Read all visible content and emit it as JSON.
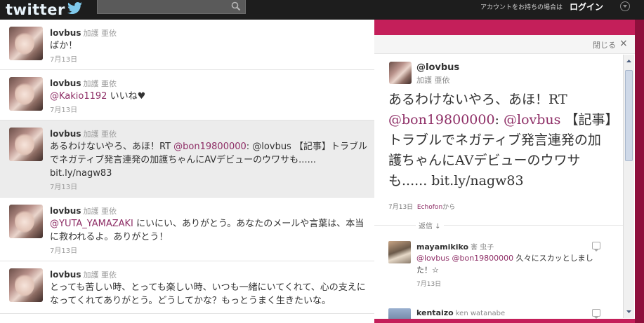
{
  "header": {
    "logo_text": "twitter",
    "search_placeholder": "",
    "account_prompt": "アカウントをお持ちの場合は",
    "login_label": "ログイン"
  },
  "timeline": [
    {
      "username": "lovbus",
      "fullname": "加護 亜依",
      "text_pre": "ばか！",
      "mention": "",
      "text_post": "",
      "time": "7月13日",
      "highlight": false
    },
    {
      "username": "lovbus",
      "fullname": "加護 亜依",
      "text_pre": "",
      "mention": "@Kakio1192",
      "text_post": " いいね♥",
      "time": "7月13日",
      "highlight": false
    },
    {
      "username": "lovbus",
      "fullname": "加護 亜依",
      "text_pre": "あるわけないやろ、あほ！RT ",
      "mention": "@bon19800000",
      "text_post": ": @lovbus 【記事】トラブルでネガティブ発言連発の加護ちゃんにAVデビューのウワサも...... bit.ly/nagw83",
      "time": "7月13日",
      "highlight": true
    },
    {
      "username": "lovbus",
      "fullname": "加護 亜依",
      "text_pre": "",
      "mention": "@YUTA_YAMAZAKI",
      "text_post": " にいにい、ありがとう。あなたのメールや言葉は、本当に救われるよ。ありがとう！",
      "time": "7月13日",
      "highlight": false
    },
    {
      "username": "lovbus",
      "fullname": "加護 亜依",
      "text_pre": "とっても苦しい時、とっても楽しい時、いつも一緒にいてくれて、心の支えになってくれてありがとう。どうしてかな？もっとうまく生きたいな。",
      "mention": "",
      "text_post": "",
      "time": "",
      "highlight": false
    }
  ],
  "detail": {
    "close_label": "閉じる",
    "close_icon": "×",
    "handle": "@lovbus",
    "fullname": "加護 亜依",
    "text_pre": "あるわけないやろ、あほ！RT ",
    "mention1": "@bon19800000",
    "text_mid": ": ",
    "mention2": "@lovbus",
    "text_post": " 【記事】トラブルでネガティブ発言連発の加護ちゃんにAVデビューのウワサも...... bit.ly/nagw83",
    "date": "7月13日",
    "source": "Echofon",
    "source_suffix": "から",
    "replies_label": "返信 ↓"
  },
  "replies": [
    {
      "username": "mayamikiko",
      "fullname": "害 虫子",
      "mention1": "@lovbus",
      "mention2": "@bon19800000",
      "text": " 久々にスカッとしました！☆",
      "time": "7月13日"
    },
    {
      "username": "kentaizo",
      "fullname": "ken watanabe",
      "mention1": "",
      "mention2": "",
      "text": "",
      "time": ""
    }
  ],
  "colors": {
    "accent": "#c41f5a",
    "link": "#8e2e66",
    "topbar": "#1d1d1d"
  }
}
